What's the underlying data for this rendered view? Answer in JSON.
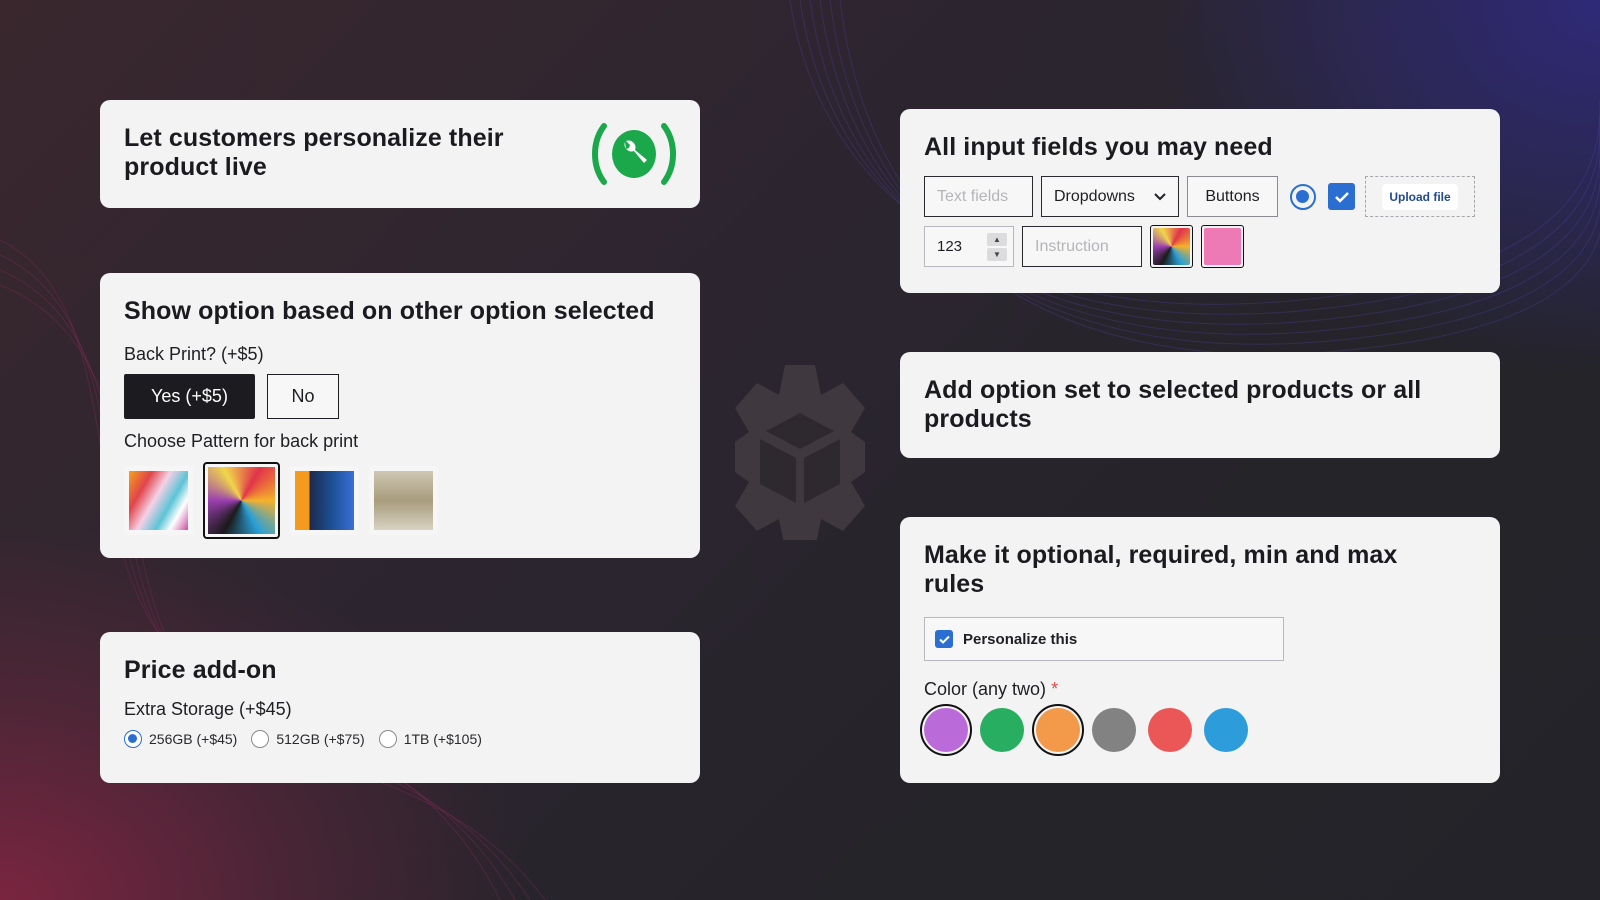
{
  "cards": {
    "personalize": {
      "title": "Let customers personalize their product live",
      "icon": "wrench-broadcast-icon",
      "icon_color": "#1aa84a"
    },
    "conditional": {
      "title": "Show option based on other option selected",
      "back_print_label": "Back Print? (+$5)",
      "back_print_options": [
        {
          "label": "Yes (+$5)",
          "selected": true
        },
        {
          "label": "No",
          "selected": false
        }
      ],
      "pattern_label": "Choose Pattern for back print",
      "patterns": [
        {
          "name": "abstract-paint",
          "selected": false
        },
        {
          "name": "colorful-face-mural",
          "selected": true
        },
        {
          "name": "woman-portrait-art",
          "selected": false
        },
        {
          "name": "castle-painting",
          "selected": false
        }
      ]
    },
    "price_addon": {
      "title": "Price add-on",
      "field_label": "Extra Storage (+$45)",
      "options": [
        {
          "label": "256GB (+$45)",
          "selected": true
        },
        {
          "label": "512GB (+$75)",
          "selected": false
        },
        {
          "label": "1TB (+$105)",
          "selected": false
        }
      ]
    },
    "input_fields": {
      "title": "All input fields you may need",
      "text_field_placeholder": "Text fields",
      "dropdown_value": "Dropdowns",
      "button_label": "Buttons",
      "upload_label": "Upload file",
      "number_value": "123",
      "instruction_placeholder": "Instruction",
      "color_swatch": "#ee7ab5",
      "accent": "#2b6ed1"
    },
    "option_set": {
      "title": "Add option set to selected products or all products"
    },
    "rules": {
      "title": "Make it optional, required, min and max rules",
      "checkbox_label": "Personalize this",
      "checkbox_checked": true,
      "color_label": "Color (any two)",
      "required_mark": "*",
      "colors": [
        {
          "hex": "#bb6bd9",
          "selected": true
        },
        {
          "hex": "#27ae60",
          "selected": false
        },
        {
          "hex": "#f2994a",
          "selected": true
        },
        {
          "hex": "#828282",
          "selected": false
        },
        {
          "hex": "#eb5757",
          "selected": false
        },
        {
          "hex": "#2d9cdb",
          "selected": false
        }
      ]
    }
  },
  "center_logo": "gear-box-icon"
}
